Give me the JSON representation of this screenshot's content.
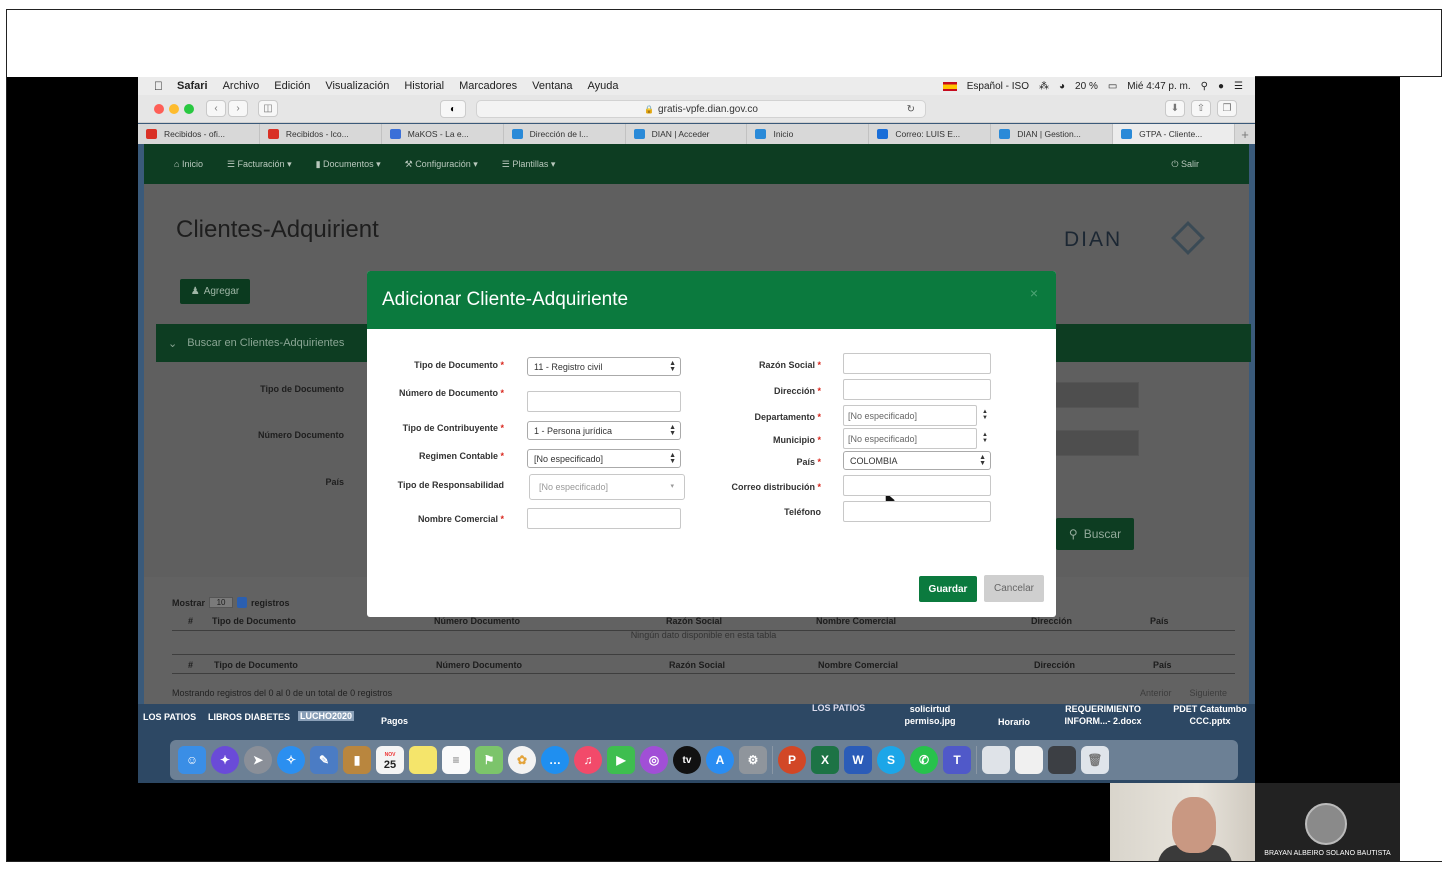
{
  "mac_menubar": {
    "app": "Safari",
    "menus": [
      "Archivo",
      "Edición",
      "Visualización",
      "Historial",
      "Marcadores",
      "Ventana",
      "Ayuda"
    ],
    "input_source": "Español - ISO",
    "battery": "20 %",
    "clock": "Mié 4:47 p. m."
  },
  "browser": {
    "url": "gratis-vpfe.dian.gov.co",
    "tabs": [
      {
        "label": "Recibidos - ofi...",
        "color": "#d93025"
      },
      {
        "label": "Recibidos - lco...",
        "color": "#d93025"
      },
      {
        "label": "MaKOS - La e...",
        "color": "#3a6fd8"
      },
      {
        "label": "Dirección de l...",
        "color": "#2a8ad8"
      },
      {
        "label": "DIAN | Acceder",
        "color": "#2a8ad8"
      },
      {
        "label": "Inicio",
        "color": "#2a8ad8"
      },
      {
        "label": "Correo: LUIS E...",
        "color": "#1a6ed8"
      },
      {
        "label": "DIAN | Gestion...",
        "color": "#2a8ad8"
      },
      {
        "label": "GTPA - Cliente...",
        "color": "#2a8ad8"
      }
    ]
  },
  "site_nav": {
    "items": [
      "Inicio",
      "Facturación",
      "Documentos",
      "Configuración",
      "Plantillas"
    ],
    "logout": "Salir"
  },
  "page": {
    "title": "Clientes-Adquirient",
    "logo": "DIAN",
    "add_button": "Agregar",
    "search_panel": "Buscar en Clientes-Adquirientes",
    "filters": {
      "doc_type": "Tipo de Documento",
      "doc_number": "Número Documento",
      "country": "País"
    },
    "search_button": "Buscar"
  },
  "table": {
    "show_label": "Mostrar",
    "page_size": "10",
    "records_label": "registros",
    "columns": [
      "#",
      "Tipo de Documento",
      "Número Documento",
      "Razón Social",
      "Nombre Comercial",
      "Dirección",
      "País"
    ],
    "empty": "Ningún dato disponible en esta tabla",
    "summary": "Mostrando registros del 0 al 0 de un total de 0 registros",
    "prev": "Anterior",
    "next": "Siguiente"
  },
  "modal": {
    "title": "Adicionar Cliente-Adquiriente",
    "close": "×",
    "fields_left": {
      "doc_type_label": "Tipo de Documento",
      "doc_type_value": "11 - Registro civil",
      "doc_number_label": "Número de Documento",
      "taxpayer_type_label": "Tipo de Contribuyente",
      "taxpayer_type_value": "1 - Persona jurídica",
      "regime_label": "Regimen Contable",
      "regime_value": "[No especificado]",
      "responsibility_label": "Tipo de Responsabilidad",
      "responsibility_placeholder": "[No especificado]",
      "trade_name_label": "Nombre Comercial"
    },
    "fields_right": {
      "company_name_label": "Razón Social",
      "address_label": "Dirección",
      "department_label": "Departamento",
      "department_value": "[No especificado]",
      "municipality_label": "Municipio",
      "municipality_value": "[No especificado]",
      "country_label": "País",
      "country_value": "COLOMBIA",
      "email_label": "Correo distribución",
      "phone_label": "Teléfono"
    },
    "required_mark": "*",
    "save": "Guardar",
    "cancel": "Cancelar"
  },
  "desktop": {
    "items": [
      "LOS PATIOS",
      "LIBROS DIABETES",
      "LUCHO2020",
      "Pagos",
      "LOS PATIOS",
      "solicirtud permiso.jpg",
      "Horario",
      "REQUERIMIENTO INFORM...- 2.docx",
      "PDET Catatumbo CCC.pptx"
    ]
  },
  "dock": {
    "calendar_day": "25",
    "calendar_month": "NOV",
    "tv": "tv",
    "icons": [
      "finder-icon",
      "siri-icon",
      "launchpad-icon",
      "safari-icon",
      "preview-icon",
      "notes-brown-icon",
      "calendar-icon",
      "stickies-icon",
      "reminders-icon",
      "maps-icon",
      "photos-icon",
      "messages-icon",
      "music-icon",
      "facetime-icon",
      "podcasts-icon",
      "appletv-icon",
      "appstore-icon",
      "settings-icon",
      "powerpoint-icon",
      "excel-icon",
      "word-icon",
      "skype-icon",
      "whatsapp-icon",
      "teams-icon",
      "screenshot-icon",
      "document-icon",
      "terminal-icon",
      "trash-icon"
    ]
  },
  "video": {
    "participant_name": "BRAYAN ALBEIRO SOLANO BAUTISTA"
  }
}
